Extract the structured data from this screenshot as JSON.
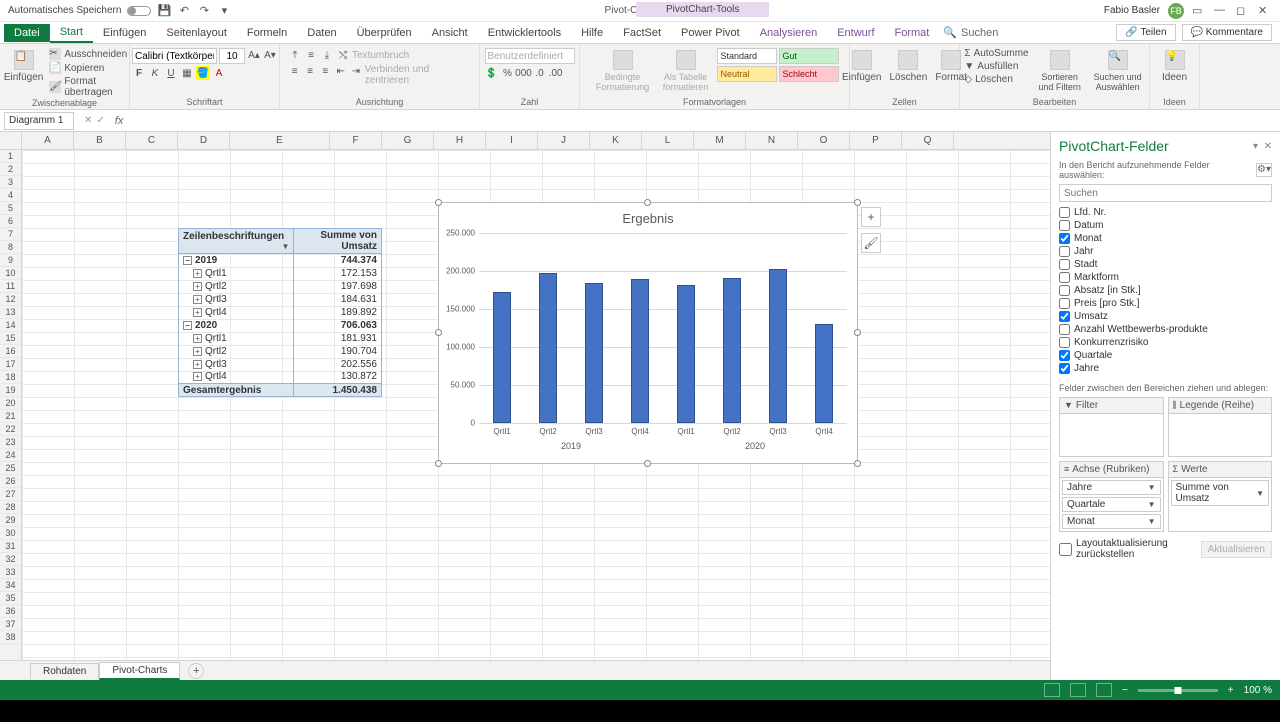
{
  "titlebar": {
    "autosave": "Automatisches Speichern",
    "doc_title": "Pivot-Charts in Excel  -  Excel",
    "contextual_title": "PivotChart-Tools",
    "user_name": "Fabio Basler",
    "user_initials": "FB"
  },
  "tabs": {
    "file": "Datei",
    "start": "Start",
    "insert": "Einfügen",
    "layout": "Seitenlayout",
    "formulas": "Formeln",
    "data": "Daten",
    "review": "Überprüfen",
    "view": "Ansicht",
    "developer": "Entwicklertools",
    "help": "Hilfe",
    "factset": "FactSet",
    "powerpivot": "Power Pivot",
    "analyze": "Analysieren",
    "design": "Entwurf",
    "format": "Format",
    "search": "Suchen",
    "share": "Teilen",
    "comments": "Kommentare"
  },
  "ribbon": {
    "clipboard": {
      "paste": "Einfügen",
      "cut": "Ausschneiden",
      "copy": "Kopieren",
      "painter": "Format übertragen",
      "label": "Zwischenablage"
    },
    "font": {
      "name": "Calibri (Textkörper)",
      "size": "10",
      "label": "Schriftart"
    },
    "align": {
      "wrap": "Textumbruch",
      "merge": "Verbinden und zentrieren",
      "label": "Ausrichtung"
    },
    "number": {
      "format": "Benutzerdefiniert",
      "label": "Zahl"
    },
    "styles": {
      "cond": "Bedingte Formatierung",
      "table": "Als Tabelle formatieren",
      "standard": "Standard",
      "gut": "Gut",
      "neutral": "Neutral",
      "schlecht": "Schlecht",
      "label": "Formatvorlagen"
    },
    "cells": {
      "insert": "Einfügen",
      "delete": "Löschen",
      "format": "Format",
      "label": "Zellen"
    },
    "editing": {
      "autosum": "AutoSumme",
      "fill": "Ausfüllen",
      "clear": "Löschen",
      "sort": "Sortieren und Filtern",
      "find": "Suchen und Auswählen",
      "label": "Bearbeiten"
    },
    "ideas": {
      "label": "Ideen"
    }
  },
  "namebox": "Diagramm 1",
  "columns": [
    "A",
    "B",
    "C",
    "D",
    "E",
    "F",
    "G",
    "H",
    "I",
    "J",
    "K",
    "L",
    "M",
    "N",
    "O",
    "P",
    "Q"
  ],
  "pivot": {
    "header_label": "Zeilenbeschriftungen",
    "header_value": "Summe von Umsatz",
    "y2019": {
      "label": "2019",
      "total": "744.374",
      "q1": "172.153",
      "q2": "197.698",
      "q3": "184.631",
      "q4": "189.892"
    },
    "y2020": {
      "label": "2020",
      "total": "706.063",
      "q1": "181.931",
      "q2": "190.704",
      "q3": "202.556",
      "q4": "130.872"
    },
    "q": {
      "q1": "Qrtl1",
      "q2": "Qrtl2",
      "q3": "Qrtl3",
      "q4": "Qrtl4"
    },
    "grand_label": "Gesamtergebnis",
    "grand_value": "1.450.438"
  },
  "chart_data": {
    "type": "bar",
    "title": "Ergebnis",
    "ylim": [
      0,
      250000
    ],
    "yticks": [
      "0",
      "50.000",
      "100.000",
      "150.000",
      "200.000",
      "250.000"
    ],
    "groups": [
      "2019",
      "2020"
    ],
    "categories": [
      "Qrtl1",
      "Qrtl2",
      "Qrtl3",
      "Qrtl4",
      "Qrtl1",
      "Qrtl2",
      "Qrtl3",
      "Qrtl4"
    ],
    "values": [
      172153,
      197698,
      184631,
      189892,
      181931,
      190704,
      202556,
      130872
    ]
  },
  "fieldpane": {
    "title": "PivotChart-Felder",
    "subtitle": "In den Bericht aufzunehmende Felder auswählen:",
    "search_placeholder": "Suchen",
    "fields": [
      {
        "label": "Lfd. Nr.",
        "checked": false
      },
      {
        "label": "Datum",
        "checked": false
      },
      {
        "label": "Monat",
        "checked": true
      },
      {
        "label": "Jahr",
        "checked": false
      },
      {
        "label": "Stadt",
        "checked": false
      },
      {
        "label": "Marktform",
        "checked": false
      },
      {
        "label": "Absatz [in Stk.]",
        "checked": false
      },
      {
        "label": "Preis [pro Stk.]",
        "checked": false
      },
      {
        "label": "Umsatz",
        "checked": true
      },
      {
        "label": "Anzahl Wettbewerbs-produkte",
        "checked": false
      },
      {
        "label": "Konkurrenzrisiko",
        "checked": false
      },
      {
        "label": "Quartale",
        "checked": true
      },
      {
        "label": "Jahre",
        "checked": true
      }
    ],
    "instructions": "Felder zwischen den Bereichen ziehen und ablegen:",
    "areas": {
      "filter": "Filter",
      "legend": "Legende (Reihe)",
      "axis": "Achse (Rubriken)",
      "values": "Werte"
    },
    "axis_items": [
      "Jahre",
      "Quartale",
      "Monat"
    ],
    "value_items": [
      "Summe von Umsatz"
    ],
    "defer": "Layoutaktualisierung zurückstellen",
    "update": "Aktualisieren"
  },
  "sheets": {
    "tab1": "Rohdaten",
    "tab2": "Pivot-Charts"
  },
  "status": {
    "zoom": "100 %"
  }
}
